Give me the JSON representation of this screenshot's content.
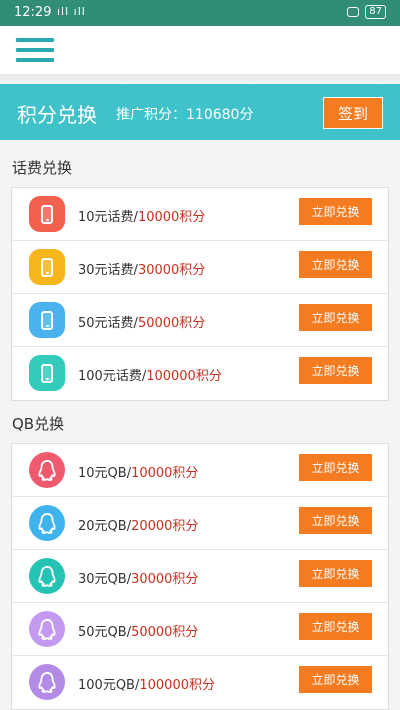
{
  "status_bar": {
    "time": "12:29",
    "signal": "ıll ıll",
    "battery": "87"
  },
  "banner": {
    "title": "积分兑换",
    "points_label": "推广积分：110680分",
    "signin_label": "签到"
  },
  "sections": {
    "phone_credit": {
      "title": "话费兑换",
      "items": [
        {
          "name": "10元话费/",
          "points": "10000积分",
          "button": "立即兑换",
          "color": "#f2614e"
        },
        {
          "name": "30元话费/",
          "points": "30000积分",
          "button": "立即兑换",
          "color": "#f7b61b"
        },
        {
          "name": "50元话费/",
          "points": "50000积分",
          "button": "立即兑换",
          "color": "#4ab3ee"
        },
        {
          "name": "100元话费/",
          "points": "100000积分",
          "button": "立即兑换",
          "color": "#33cbbb"
        }
      ]
    },
    "qb": {
      "title": "QB兑换",
      "items": [
        {
          "name": "10元QB/",
          "points": "10000积分",
          "button": "立即兑换",
          "color": "#f05a6e"
        },
        {
          "name": "20元QB/",
          "points": "20000积分",
          "button": "立即兑换",
          "color": "#3fb3ee"
        },
        {
          "name": "30元QB/",
          "points": "30000积分",
          "button": "立即兑换",
          "color": "#25c3b3"
        },
        {
          "name": "50元QB/",
          "points": "50000积分",
          "button": "立即兑换",
          "color": "#c49af0"
        },
        {
          "name": "100元QB/",
          "points": "100000积分",
          "button": "立即兑换",
          "color": "#b38ae6"
        }
      ]
    }
  },
  "icons": {
    "menu": "hamburger-menu-icon",
    "phone": "mobile-phone-icon",
    "qq": "qq-penguin-icon"
  }
}
